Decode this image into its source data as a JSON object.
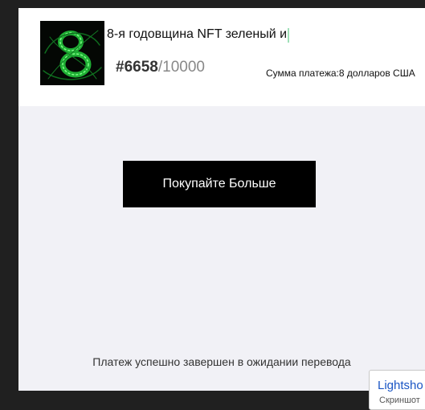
{
  "nft": {
    "title": "8-я годовщина NFT зеленый и",
    "number_current": "#6658",
    "number_total": "/10000",
    "payment_label": "Сумма платежа:",
    "payment_amount": "8 долларов США",
    "thumbnail_icon": "green-eight-nft-image"
  },
  "actions": {
    "buy_more_label": "Покупайте Больше"
  },
  "status": {
    "message": "Платеж успешно завершен в ожидании перевода"
  },
  "tooltip": {
    "title": "Lightsho",
    "subtitle": "Скриншот"
  },
  "colors": {
    "background": "#202020",
    "panel": "#f1f1f6",
    "header": "#ffffff",
    "button": "#000000",
    "nft_accent": "#2ecc40"
  }
}
